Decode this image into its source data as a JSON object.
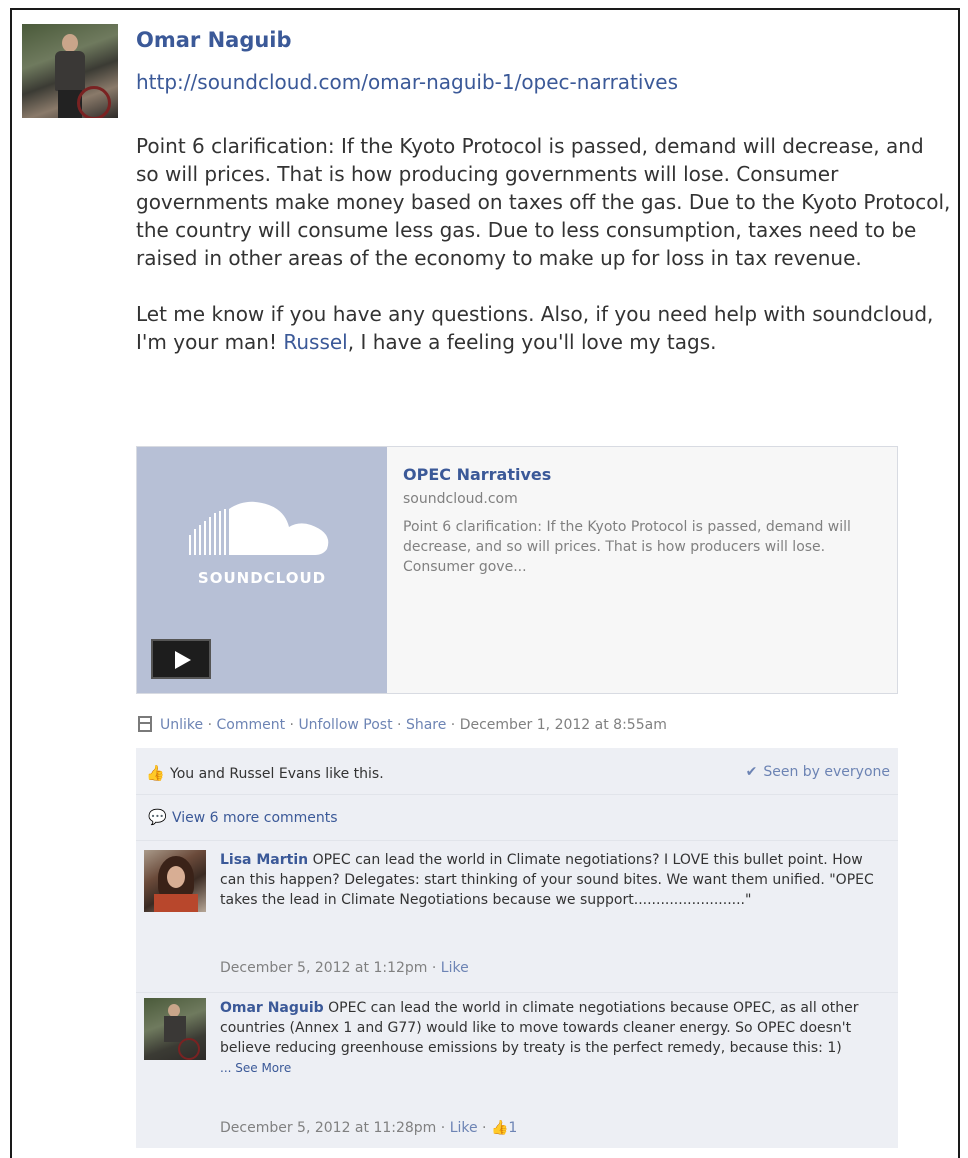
{
  "post": {
    "author": "Omar Naguib",
    "link": "http://soundcloud.com/omar-naguib-1/opec-narratives",
    "paragraph1": "Point 6 clarification: If the Kyoto Protocol is passed, demand will decrease, and so will prices. That is how producing governments will lose. Consumer governments make money based on taxes off the gas. Due to the Kyoto Protocol, the country will consume less gas. Due to less consumption, taxes need to be raised in other areas of the economy to make up for loss in tax revenue.",
    "paragraph2_before": "Let me know if you have any questions. Also, if you need help with soundcloud, I'm your man! ",
    "paragraph2_mention": "Russel",
    "paragraph2_after": ", I have a feeling you'll love my tags."
  },
  "share_card": {
    "brand_word": "SOUNDCLOUD",
    "title": "OPEC Narratives",
    "domain": "soundcloud.com",
    "description": "Point 6 clarification: If the Kyoto Protocol is passed, demand will decrease, and so will prices. That is how producers will lose. Consumer gove...",
    "thumbnail_color": "#b7c0d6"
  },
  "actions": {
    "unlike": "Unlike",
    "comment": "Comment",
    "unfollow": "Unfollow Post",
    "share": "Share",
    "sep": " · ",
    "timestamp": "December 1, 2012 at 8:55am"
  },
  "feedback": {
    "likes_text": "You and Russel Evans like this.",
    "seen_text": "Seen by everyone",
    "view_more": "View 6 more comments"
  },
  "comments": [
    {
      "author": "Lisa Martin",
      "text": " OPEC can lead the world in Climate negotiations? I LOVE this bullet point. How can this happen? Delegates: start thinking of your sound bites. We want them unified. \"OPEC takes the lead in Climate Negotiations because we support.........................\"",
      "timestamp": "December 5, 2012 at 1:12pm",
      "like": "Like"
    },
    {
      "author": "Omar Naguib",
      "text": " OPEC can lead the world in climate negotiations because OPEC, as all other countries (Annex 1 and G77) would like to move towards cleaner energy. So OPEC doesn't believe reducing greenhouse emissions by treaty is the perfect remedy, because this: 1)",
      "see_more": "... See More",
      "timestamp": "December 5, 2012 at 11:28pm",
      "like": "Like",
      "like_count": "1"
    }
  ],
  "colors": {
    "link_blue": "#3b5998",
    "muted_link": "#6d84b4",
    "feedback_bg": "#edeff4"
  }
}
